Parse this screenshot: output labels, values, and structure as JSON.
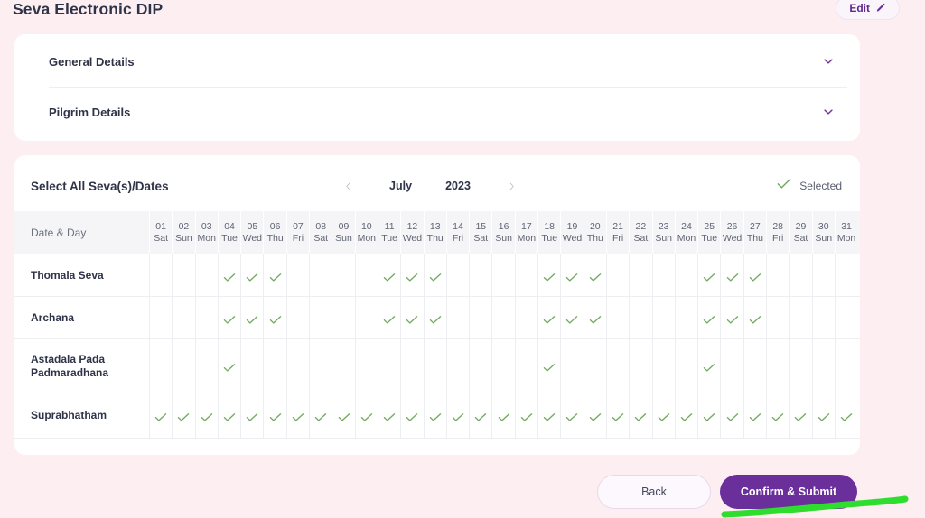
{
  "header": {
    "title": "Seva Electronic DIP",
    "edit_label": "Edit",
    "edit_icon": "pencil-icon"
  },
  "accordions": [
    {
      "label": "General Details",
      "icon": "chevron-down-icon"
    },
    {
      "label": "Pilgrim Details",
      "icon": "chevron-down-icon"
    }
  ],
  "seva_panel": {
    "title": "Select All Seva(s)/Dates",
    "prev_icon": "chevron-left-icon",
    "next_icon": "chevron-right-icon",
    "month": "July",
    "year": "2023",
    "legend_icon": "check-icon",
    "legend_label": "Selected",
    "date_column_header": "Date & Day",
    "check_icon": "check-icon",
    "accent_purple": "#6b2f9c",
    "check_green": "#6faa5e",
    "page_background": "#fdeef1"
  },
  "calendar": {
    "days": [
      {
        "num": "01",
        "dow": "Sat"
      },
      {
        "num": "02",
        "dow": "Sun"
      },
      {
        "num": "03",
        "dow": "Mon"
      },
      {
        "num": "04",
        "dow": "Tue"
      },
      {
        "num": "05",
        "dow": "Wed"
      },
      {
        "num": "06",
        "dow": "Thu"
      },
      {
        "num": "07",
        "dow": "Fri"
      },
      {
        "num": "08",
        "dow": "Sat"
      },
      {
        "num": "09",
        "dow": "Sun"
      },
      {
        "num": "10",
        "dow": "Mon"
      },
      {
        "num": "11",
        "dow": "Tue"
      },
      {
        "num": "12",
        "dow": "Wed"
      },
      {
        "num": "13",
        "dow": "Thu"
      },
      {
        "num": "14",
        "dow": "Fri"
      },
      {
        "num": "15",
        "dow": "Sat"
      },
      {
        "num": "16",
        "dow": "Sun"
      },
      {
        "num": "17",
        "dow": "Mon"
      },
      {
        "num": "18",
        "dow": "Tue"
      },
      {
        "num": "19",
        "dow": "Wed"
      },
      {
        "num": "20",
        "dow": "Thu"
      },
      {
        "num": "21",
        "dow": "Fri"
      },
      {
        "num": "22",
        "dow": "Sat"
      },
      {
        "num": "23",
        "dow": "Sun"
      },
      {
        "num": "24",
        "dow": "Mon"
      },
      {
        "num": "25",
        "dow": "Tue"
      },
      {
        "num": "26",
        "dow": "Wed"
      },
      {
        "num": "27",
        "dow": "Thu"
      },
      {
        "num": "28",
        "dow": "Fri"
      },
      {
        "num": "29",
        "dow": "Sat"
      },
      {
        "num": "30",
        "dow": "Sun"
      },
      {
        "num": "31",
        "dow": "Mon"
      }
    ]
  },
  "sevas": [
    {
      "name": "Thomala Seva",
      "height_class": "r-h1",
      "selected_days": [
        4,
        5,
        6,
        11,
        12,
        13,
        18,
        19,
        20,
        25,
        26,
        27
      ]
    },
    {
      "name": "Archana",
      "height_class": "r-h2",
      "selected_days": [
        4,
        5,
        6,
        11,
        12,
        13,
        18,
        19,
        20,
        25,
        26,
        27
      ]
    },
    {
      "name": "Astadala Pada Padmaradhana",
      "height_class": "r-h3",
      "selected_days": [
        4,
        18,
        25
      ]
    },
    {
      "name": "Suprabhatham",
      "height_class": "r-h4",
      "selected_days": [
        1,
        2,
        3,
        4,
        5,
        6,
        7,
        8,
        9,
        10,
        11,
        12,
        13,
        14,
        15,
        16,
        17,
        18,
        19,
        20,
        21,
        22,
        23,
        24,
        25,
        26,
        27,
        28,
        29,
        30,
        31
      ]
    }
  ],
  "footer": {
    "back_label": "Back",
    "confirm_label": "Confirm & Submit",
    "annotation": "green-highlight-stroke"
  }
}
